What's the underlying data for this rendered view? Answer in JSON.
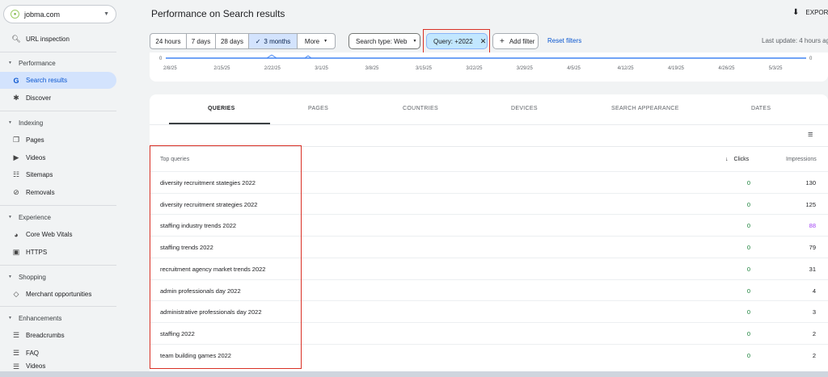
{
  "property": {
    "name": "jobma.com"
  },
  "sidebar": {
    "url_inspection": "URL inspection",
    "performance_section": "Performance",
    "search_results": "Search results",
    "discover": "Discover",
    "indexing_section": "Indexing",
    "pages": "Pages",
    "videos": "Videos",
    "sitemaps": "Sitemaps",
    "removals": "Removals",
    "experience_section": "Experience",
    "core_web_vitals": "Core Web Vitals",
    "https": "HTTPS",
    "shopping_section": "Shopping",
    "merchant_opportunities": "Merchant opportunities",
    "enhancements_section": "Enhancements",
    "breadcrumbs": "Breadcrumbs",
    "faq": "FAQ",
    "videos2": "Videos"
  },
  "header": {
    "title": "Performance on Search results",
    "export": "EXPORT",
    "last_update": "Last update: 4 hours ago"
  },
  "filters": {
    "range_24h": "24 hours",
    "range_7d": "7 days",
    "range_28d": "28 days",
    "range_3m": "3 months",
    "more": "More",
    "search_type": "Search type: Web",
    "query": "Query: +2022",
    "add_filter": "Add filter",
    "reset": "Reset filters"
  },
  "chart": {
    "left_zero": "0",
    "right_zero": "0",
    "dates": [
      "2/8/25",
      "2/15/25",
      "2/22/25",
      "3/1/25",
      "3/8/25",
      "3/15/25",
      "3/22/25",
      "3/29/25",
      "4/5/25",
      "4/12/25",
      "4/19/25",
      "4/26/25",
      "5/3/25"
    ]
  },
  "tabs": {
    "queries": "QUERIES",
    "pages": "PAGES",
    "countries": "COUNTRIES",
    "devices": "DEVICES",
    "search_appearance": "SEARCH APPEARANCE",
    "dates": "DATES"
  },
  "table": {
    "col_query": "Top queries",
    "col_clicks": "Clicks",
    "col_impressions": "Impressions",
    "rows": [
      {
        "query": "diversity recruitment stategies 2022",
        "clicks": "0",
        "impressions": "130"
      },
      {
        "query": "diversity recruitment strategies 2022",
        "clicks": "0",
        "impressions": "125"
      },
      {
        "query": "staffing industry trends 2022",
        "clicks": "0",
        "impressions": "88"
      },
      {
        "query": "staffing trends 2022",
        "clicks": "0",
        "impressions": "79"
      },
      {
        "query": "recruitment agency market trends 2022",
        "clicks": "0",
        "impressions": "31"
      },
      {
        "query": "admin professionals day 2022",
        "clicks": "0",
        "impressions": "4"
      },
      {
        "query": "administrative professionals day 2022",
        "clicks": "0",
        "impressions": "3"
      },
      {
        "query": "staffing 2022",
        "clicks": "0",
        "impressions": "2"
      },
      {
        "query": "team building games 2022",
        "clicks": "0",
        "impressions": "2"
      }
    ]
  },
  "colors": {
    "accent": "#0b57d0",
    "highlight": "#d93025",
    "clicks_green": "#188038"
  }
}
